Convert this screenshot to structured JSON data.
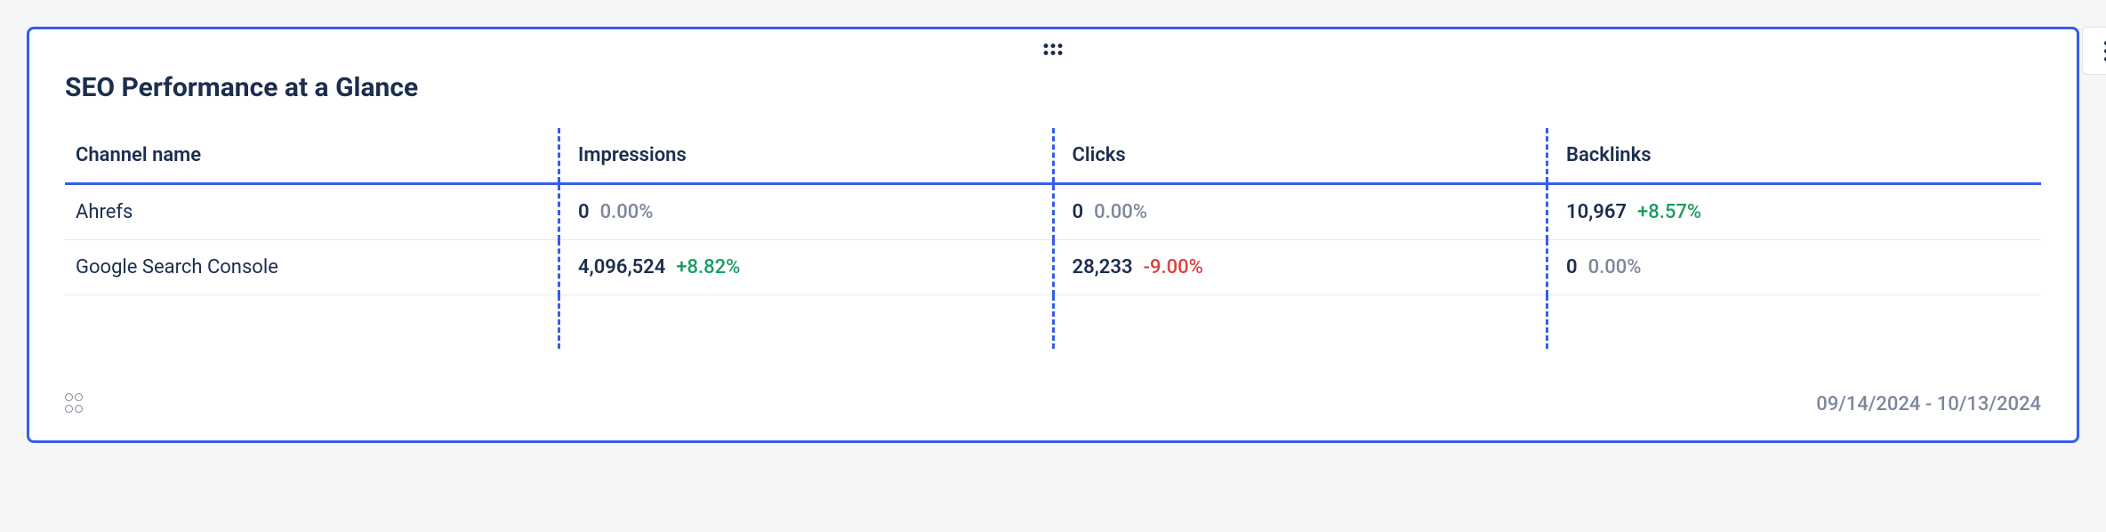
{
  "card": {
    "title": "SEO Performance at a Glance",
    "dateRange": "09/14/2024 - 10/13/2024"
  },
  "table": {
    "headers": {
      "channel": "Channel name",
      "impressions": "Impressions",
      "clicks": "Clicks",
      "backlinks": "Backlinks"
    },
    "rows": [
      {
        "channel": "Ahrefs",
        "impressions": {
          "value": "0",
          "change": "0.00%",
          "changeType": "neutral"
        },
        "clicks": {
          "value": "0",
          "change": "0.00%",
          "changeType": "neutral"
        },
        "backlinks": {
          "value": "10,967",
          "change": "+8.57%",
          "changeType": "positive"
        }
      },
      {
        "channel": "Google Search Console",
        "impressions": {
          "value": "4,096,524",
          "change": "+8.82%",
          "changeType": "positive"
        },
        "clicks": {
          "value": "28,233",
          "change": "-9.00%",
          "changeType": "negative"
        },
        "backlinks": {
          "value": "0",
          "change": "0.00%",
          "changeType": "neutral"
        }
      }
    ]
  }
}
